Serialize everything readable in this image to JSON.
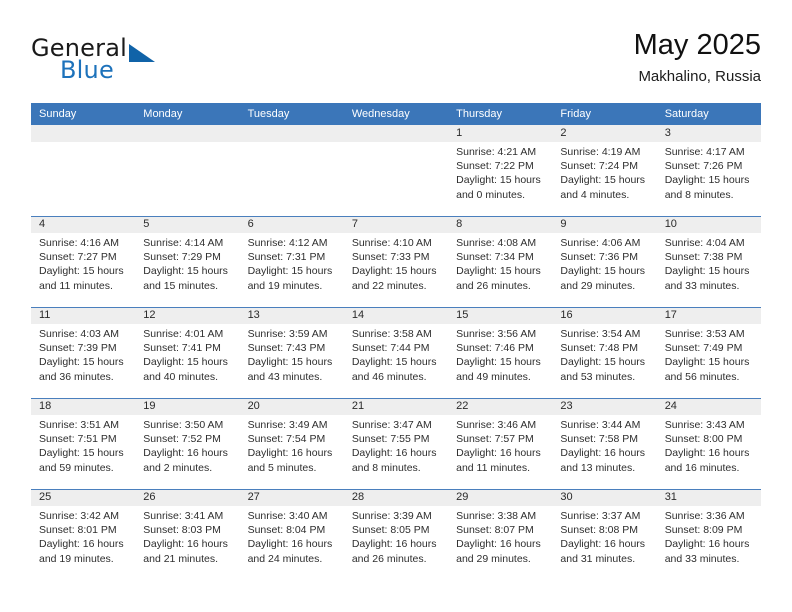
{
  "brand": {
    "word_one": "General",
    "word_two": "Blue",
    "triangle_icon": "brand-triangle-icon"
  },
  "header": {
    "month_title": "May 2025",
    "location": "Makhalino, Russia"
  },
  "calendar": {
    "weekday_headers": [
      "Sunday",
      "Monday",
      "Tuesday",
      "Wednesday",
      "Thursday",
      "Friday",
      "Saturday"
    ],
    "header_bg": "#3b76b9",
    "day_bar_bg": "#eeeeee",
    "weeks": [
      [
        {
          "day": "",
          "empty": true
        },
        {
          "day": "",
          "empty": true
        },
        {
          "day": "",
          "empty": true
        },
        {
          "day": "",
          "empty": true
        },
        {
          "day": "1",
          "sunrise": "Sunrise: 4:21 AM",
          "sunset": "Sunset: 7:22 PM",
          "daylight": "Daylight: 15 hours and 0 minutes."
        },
        {
          "day": "2",
          "sunrise": "Sunrise: 4:19 AM",
          "sunset": "Sunset: 7:24 PM",
          "daylight": "Daylight: 15 hours and 4 minutes."
        },
        {
          "day": "3",
          "sunrise": "Sunrise: 4:17 AM",
          "sunset": "Sunset: 7:26 PM",
          "daylight": "Daylight: 15 hours and 8 minutes."
        }
      ],
      [
        {
          "day": "4",
          "sunrise": "Sunrise: 4:16 AM",
          "sunset": "Sunset: 7:27 PM",
          "daylight": "Daylight: 15 hours and 11 minutes."
        },
        {
          "day": "5",
          "sunrise": "Sunrise: 4:14 AM",
          "sunset": "Sunset: 7:29 PM",
          "daylight": "Daylight: 15 hours and 15 minutes."
        },
        {
          "day": "6",
          "sunrise": "Sunrise: 4:12 AM",
          "sunset": "Sunset: 7:31 PM",
          "daylight": "Daylight: 15 hours and 19 minutes."
        },
        {
          "day": "7",
          "sunrise": "Sunrise: 4:10 AM",
          "sunset": "Sunset: 7:33 PM",
          "daylight": "Daylight: 15 hours and 22 minutes."
        },
        {
          "day": "8",
          "sunrise": "Sunrise: 4:08 AM",
          "sunset": "Sunset: 7:34 PM",
          "daylight": "Daylight: 15 hours and 26 minutes."
        },
        {
          "day": "9",
          "sunrise": "Sunrise: 4:06 AM",
          "sunset": "Sunset: 7:36 PM",
          "daylight": "Daylight: 15 hours and 29 minutes."
        },
        {
          "day": "10",
          "sunrise": "Sunrise: 4:04 AM",
          "sunset": "Sunset: 7:38 PM",
          "daylight": "Daylight: 15 hours and 33 minutes."
        }
      ],
      [
        {
          "day": "11",
          "sunrise": "Sunrise: 4:03 AM",
          "sunset": "Sunset: 7:39 PM",
          "daylight": "Daylight: 15 hours and 36 minutes."
        },
        {
          "day": "12",
          "sunrise": "Sunrise: 4:01 AM",
          "sunset": "Sunset: 7:41 PM",
          "daylight": "Daylight: 15 hours and 40 minutes."
        },
        {
          "day": "13",
          "sunrise": "Sunrise: 3:59 AM",
          "sunset": "Sunset: 7:43 PM",
          "daylight": "Daylight: 15 hours and 43 minutes."
        },
        {
          "day": "14",
          "sunrise": "Sunrise: 3:58 AM",
          "sunset": "Sunset: 7:44 PM",
          "daylight": "Daylight: 15 hours and 46 minutes."
        },
        {
          "day": "15",
          "sunrise": "Sunrise: 3:56 AM",
          "sunset": "Sunset: 7:46 PM",
          "daylight": "Daylight: 15 hours and 49 minutes."
        },
        {
          "day": "16",
          "sunrise": "Sunrise: 3:54 AM",
          "sunset": "Sunset: 7:48 PM",
          "daylight": "Daylight: 15 hours and 53 minutes."
        },
        {
          "day": "17",
          "sunrise": "Sunrise: 3:53 AM",
          "sunset": "Sunset: 7:49 PM",
          "daylight": "Daylight: 15 hours and 56 minutes."
        }
      ],
      [
        {
          "day": "18",
          "sunrise": "Sunrise: 3:51 AM",
          "sunset": "Sunset: 7:51 PM",
          "daylight": "Daylight: 15 hours and 59 minutes."
        },
        {
          "day": "19",
          "sunrise": "Sunrise: 3:50 AM",
          "sunset": "Sunset: 7:52 PM",
          "daylight": "Daylight: 16 hours and 2 minutes."
        },
        {
          "day": "20",
          "sunrise": "Sunrise: 3:49 AM",
          "sunset": "Sunset: 7:54 PM",
          "daylight": "Daylight: 16 hours and 5 minutes."
        },
        {
          "day": "21",
          "sunrise": "Sunrise: 3:47 AM",
          "sunset": "Sunset: 7:55 PM",
          "daylight": "Daylight: 16 hours and 8 minutes."
        },
        {
          "day": "22",
          "sunrise": "Sunrise: 3:46 AM",
          "sunset": "Sunset: 7:57 PM",
          "daylight": "Daylight: 16 hours and 11 minutes."
        },
        {
          "day": "23",
          "sunrise": "Sunrise: 3:44 AM",
          "sunset": "Sunset: 7:58 PM",
          "daylight": "Daylight: 16 hours and 13 minutes."
        },
        {
          "day": "24",
          "sunrise": "Sunrise: 3:43 AM",
          "sunset": "Sunset: 8:00 PM",
          "daylight": "Daylight: 16 hours and 16 minutes."
        }
      ],
      [
        {
          "day": "25",
          "sunrise": "Sunrise: 3:42 AM",
          "sunset": "Sunset: 8:01 PM",
          "daylight": "Daylight: 16 hours and 19 minutes."
        },
        {
          "day": "26",
          "sunrise": "Sunrise: 3:41 AM",
          "sunset": "Sunset: 8:03 PM",
          "daylight": "Daylight: 16 hours and 21 minutes."
        },
        {
          "day": "27",
          "sunrise": "Sunrise: 3:40 AM",
          "sunset": "Sunset: 8:04 PM",
          "daylight": "Daylight: 16 hours and 24 minutes."
        },
        {
          "day": "28",
          "sunrise": "Sunrise: 3:39 AM",
          "sunset": "Sunset: 8:05 PM",
          "daylight": "Daylight: 16 hours and 26 minutes."
        },
        {
          "day": "29",
          "sunrise": "Sunrise: 3:38 AM",
          "sunset": "Sunset: 8:07 PM",
          "daylight": "Daylight: 16 hours and 29 minutes."
        },
        {
          "day": "30",
          "sunrise": "Sunrise: 3:37 AM",
          "sunset": "Sunset: 8:08 PM",
          "daylight": "Daylight: 16 hours and 31 minutes."
        },
        {
          "day": "31",
          "sunrise": "Sunrise: 3:36 AM",
          "sunset": "Sunset: 8:09 PM",
          "daylight": "Daylight: 16 hours and 33 minutes."
        }
      ]
    ]
  }
}
